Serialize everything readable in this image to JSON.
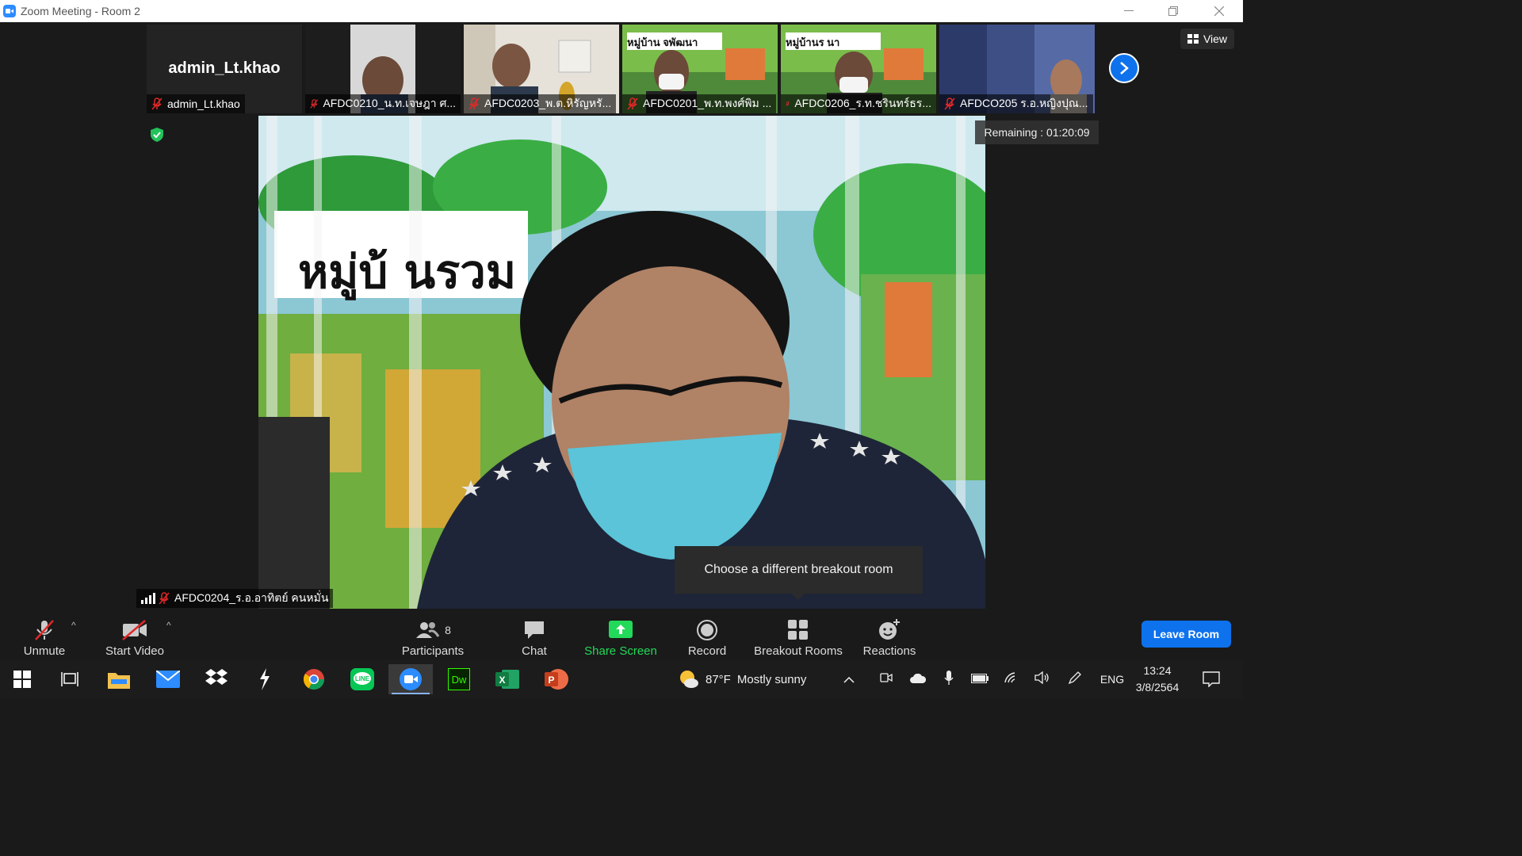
{
  "window": {
    "title": "Zoom Meeting - Room 2"
  },
  "gallery": {
    "self_name": "admin_Lt.khao",
    "self_caption": "admin_Lt.khao",
    "tiles": [
      "AFDC0210_น.ท.เจษฎา ศ...",
      "AFDC0203_พ.ต.หิรัญหรั...",
      "AFDC0201_พ.ท.พงศ์พิม ...",
      "AFDC0206_ร.ท.ชรินทร์ธร...",
      "AFDCO205 ร.อ.หญิงปุณ..."
    ],
    "banner_1": "หมู่บ้าน       จพัฒนา",
    "banner_2": "หมู่บ้านร        นา"
  },
  "view_button": "View",
  "remaining": "Remaining : 01:20:09",
  "main": {
    "banner": "หมู่บ้ นรวม",
    "speaker": "AFDC0204_ร.อ.อาทิตย์ คนหมั่น"
  },
  "tooltip": "Choose a different breakout room",
  "toolbar": {
    "unmute": "Unmute",
    "start_video": "Start Video",
    "participants": "Participants",
    "participants_count": "8",
    "chat": "Chat",
    "share_screen": "Share Screen",
    "record": "Record",
    "breakout_rooms": "Breakout Rooms",
    "reactions": "Reactions",
    "leave": "Leave Room"
  },
  "taskbar": {
    "weather_temp": "87°F",
    "weather_text": "Mostly sunny",
    "language": "ENG",
    "time": "13:24",
    "date": "3/8/2564"
  },
  "colors": {
    "accent": "#0e72ed",
    "muted_red": "#e02828",
    "share_green": "#23d959"
  }
}
